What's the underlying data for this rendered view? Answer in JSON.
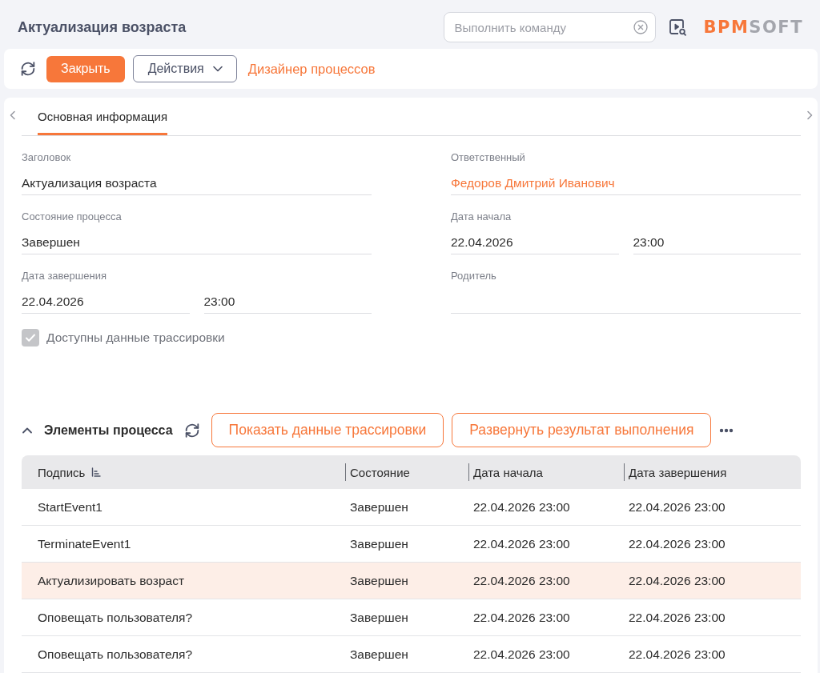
{
  "header": {
    "title": "Актуализация возраста",
    "command_field": {
      "placeholder": "Выполнить команду"
    },
    "logo": [
      "BPM",
      "SOFT"
    ]
  },
  "toolbar": {
    "buttons": [
      {
        "label": "Закрыть",
        "kind": "primary"
      },
      {
        "label": "Действия",
        "kind": "dropdown"
      },
      {
        "label": "Дизайнер процессов",
        "kind": "link"
      }
    ]
  },
  "tabs": [
    {
      "label": "Основная информация",
      "selected": true
    }
  ],
  "form": {
    "left_column": [
      {
        "label": "Заголовок",
        "kind": "text",
        "value": "Актуализация возраста"
      },
      {
        "label": "Состояние процесса",
        "kind": "text",
        "value": "Завершен"
      },
      {
        "label": "Дата завершения",
        "kind": "datetime",
        "date": "22.04.2026",
        "time": "23:00"
      }
    ],
    "right_column": [
      {
        "label": "Ответственный",
        "kind": "lookup",
        "value": "Федоров Дмитрий Иванович"
      },
      {
        "label": "Дата начала",
        "kind": "datetime",
        "date": "22.04.2026",
        "time": "23:00"
      },
      {
        "label": "Родитель",
        "kind": "lookup"
      }
    ],
    "checkbox": {
      "label": "Доступны данные трассировки",
      "checked": true,
      "disabled": true
    }
  },
  "process_elements": {
    "title": "Элементы процесса",
    "expanded": true,
    "buttons": [
      "Показать данные трассировки",
      "Развернуть результат выполнения"
    ],
    "table": {
      "columns": [
        {
          "label": "Подпись",
          "sorted": true
        },
        {
          "label": "Состояние",
          "sorted": false
        },
        {
          "label": "Дата начала",
          "sorted": false
        },
        {
          "label": "Дата завершения",
          "sorted": false
        }
      ],
      "rows": [
        {
          "cells": [
            "StartEvent1",
            "Завершен",
            "22.04.2026 23:00",
            "22.04.2026 23:00"
          ],
          "selected": false
        },
        {
          "cells": [
            "TerminateEvent1",
            "Завершен",
            "22.04.2026 23:00",
            "22.04.2026 23:00"
          ],
          "selected": false
        },
        {
          "cells": [
            "Актуализировать возраст",
            "Завершен",
            "22.04.2026 23:00",
            "22.04.2026 23:00"
          ],
          "selected": true
        },
        {
          "cells": [
            "Оповещать пользователя?",
            "Завершен",
            "22.04.2026 23:00",
            "22.04.2026 23:00"
          ],
          "selected": false
        },
        {
          "cells": [
            "Оповещать пользователя?",
            "Завершен",
            "22.04.2026 23:00",
            "22.04.2026 23:00"
          ],
          "selected": false
        }
      ]
    }
  }
}
